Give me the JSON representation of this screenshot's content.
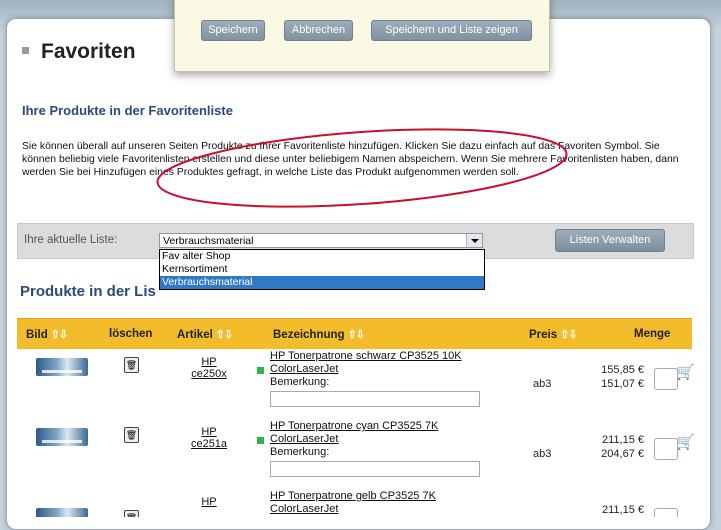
{
  "page_title": "Favoriten",
  "dialog": {
    "save_label": "Speichern",
    "cancel_label": "Abbrechen",
    "save_show_label": "Speichern und Liste zeigen"
  },
  "section_heading": "Ihre Produkte in der Favoritenliste",
  "intro_text": "Sie können überall auf unseren Seiten Produkte zu Ihrer Favoritenliste hinzufügen. Klicken Sie dazu einfach auf das Favoriten Symbol. Sie können beliebig viele Favoritenlisten erstellen und diese unter beliebigem Namen abspeichern. Wenn Sie mehrere Favoritenlisten haben, dann werden Sie bei Hinzufügen eines Produktes gefragt, in welche Liste das Produkt aufgenommen werden soll.",
  "list_selector": {
    "label": "Ihre aktuelle Liste:",
    "selected": "Verbrauchsmaterial",
    "options": [
      "Fav alter Shop",
      "Kernsortiment",
      "Verbrauchsmaterial"
    ],
    "manage_button": "Listen Verwalten"
  },
  "products_heading": "Produkte in der Lis",
  "table": {
    "headers": {
      "bild": "Bild",
      "loeschen": "löschen",
      "artikel": "Artikel",
      "bezeichnung": "Bezeichnung",
      "preis": "Preis",
      "menge": "Menge"
    },
    "rows": [
      {
        "brand": "HP",
        "sku": "ce250x",
        "name": "HP Tonerpatrone schwarz CP3525 10K ColorLaserJet",
        "remark_label": "Bemerkung:",
        "price": "155,85 €",
        "tier": "ab3",
        "tier_price": "151,07 €"
      },
      {
        "brand": "HP",
        "sku": "ce251a",
        "name": "HP Tonerpatrone cyan CP3525 7K ColorLaserJet",
        "remark_label": "Bemerkung:",
        "price": "211,15 €",
        "tier": "ab3",
        "tier_price": "204,67 €"
      },
      {
        "brand": "HP",
        "sku": "",
        "name": "HP Tonerpatrone gelb CP3525 7K ColorLaserJet",
        "remark_label": "",
        "price": "211,15 €",
        "tier": "",
        "tier_price": ""
      }
    ]
  },
  "colors": {
    "accent_heading": "#2b4a7a",
    "table_header": "#f2bc2b",
    "annotation": "#c8102e"
  }
}
